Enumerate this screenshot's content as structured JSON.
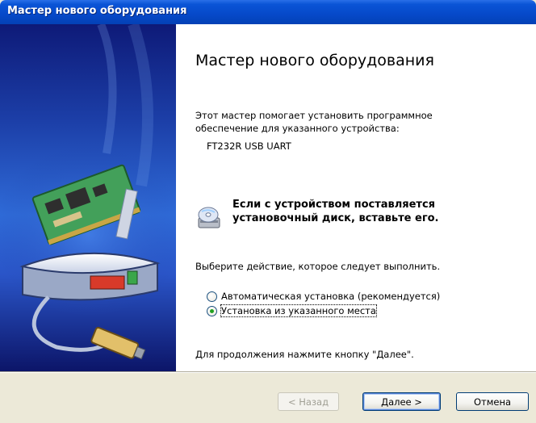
{
  "window": {
    "title": "Мастер нового оборудования"
  },
  "wizard": {
    "heading": "Мастер нового оборудования",
    "intro_line1": "Этот мастер помогает установить программное",
    "intro_line2": "обеспечение для указанного устройства:",
    "device_name": "FT232R USB UART",
    "disk_line1": "Если с устройством поставляется",
    "disk_line2": "установочный диск, вставьте его.",
    "choose_action": "Выберите действие, которое следует выполнить.",
    "options": [
      {
        "label": "Автоматическая установка (рекомендуется)",
        "checked": false
      },
      {
        "label": "Установка из указанного места",
        "checked": true
      }
    ],
    "continue_hint": "Для продолжения нажмите кнопку \"Далее\"."
  },
  "buttons": {
    "back": "< Назад",
    "next": "Далее >",
    "cancel": "Отмена"
  },
  "icons": {
    "illustration": "hardware-illustration",
    "disk": "cd-disk-icon"
  },
  "colors": {
    "titlebar": "#0a54d6",
    "left_panel": "#1c3fa8",
    "radio_dot": "#21a121"
  }
}
